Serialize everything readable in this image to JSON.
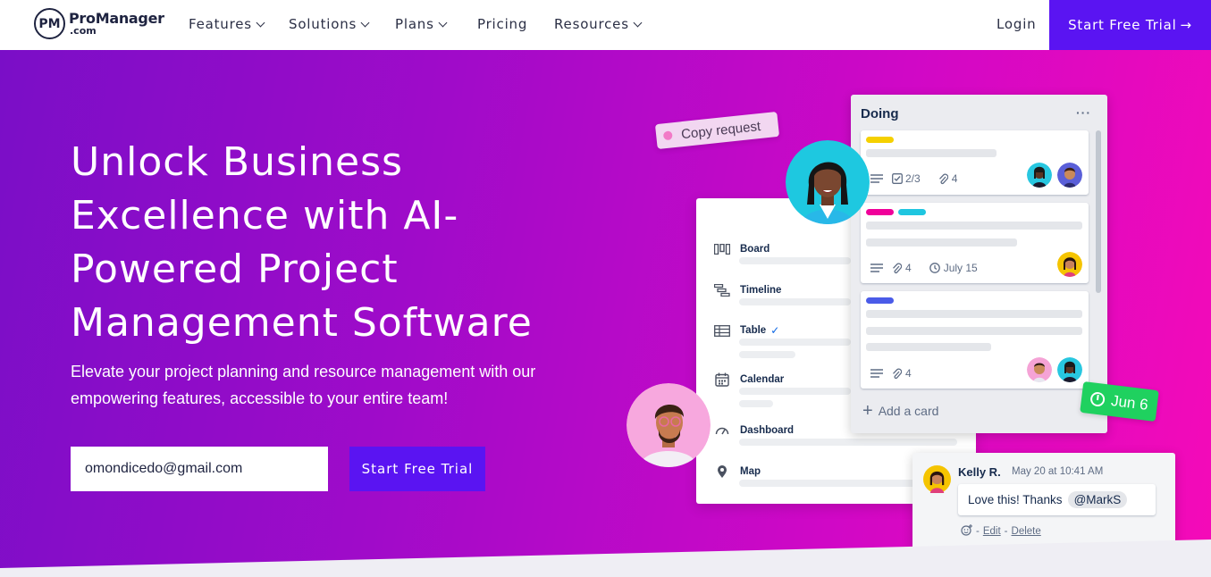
{
  "nav": {
    "logo_mark": "PM",
    "logo_name": "ProManager",
    "logo_domain": ".com",
    "items": [
      {
        "label": "Features"
      },
      {
        "label": "Solutions"
      },
      {
        "label": "Plans"
      },
      {
        "label": "Pricing"
      },
      {
        "label": "Resources"
      }
    ],
    "login": "Login",
    "cta": "Start Free Trial"
  },
  "hero": {
    "headline": "Unlock Business Excellence with AI-Powered Project Management Software",
    "subtext": "Elevate your project planning and resource management with our empowering features, accessible to your entire team!",
    "email_value": "omondicedo@gmail.com",
    "cta": "Start Free Trial"
  },
  "illustration": {
    "copy_request": "Copy request",
    "views": [
      {
        "label": "Board"
      },
      {
        "label": "Timeline"
      },
      {
        "label": "Table"
      },
      {
        "label": "Calendar"
      },
      {
        "label": "Dashboard"
      },
      {
        "label": "Map"
      }
    ],
    "doing_title": "Doing",
    "card1": {
      "checklist": "2/3",
      "attachments": "4"
    },
    "card2": {
      "attachments": "4",
      "due": "July 15"
    },
    "card3": {
      "attachments": "4"
    },
    "add_card": "Add a card",
    "due_badge": "Jun 6",
    "comment": {
      "author": "Kelly R.",
      "date": "May 20 at 10:41 AM",
      "text": "Love this! Thanks",
      "mention": "@MarkS",
      "edit": "Edit",
      "delete": "Delete"
    }
  },
  "colors": {
    "brand_purple": "#5a14f2",
    "gradient_start": "#7a0ec7",
    "gradient_end": "#f50ab8",
    "due_green": "#1fd15f"
  }
}
